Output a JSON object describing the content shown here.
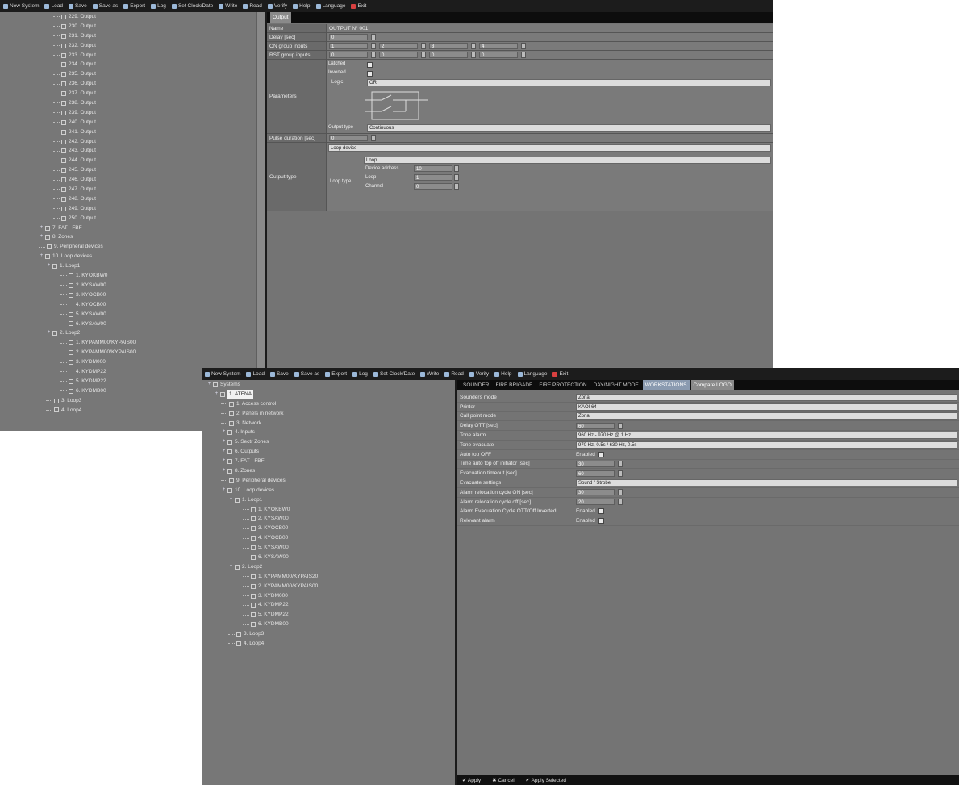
{
  "window1": {
    "top_mark": "-",
    "menu": [
      "New System",
      "Load",
      "Save",
      "Save as",
      "Export",
      "Log",
      "Set Clock/Date",
      "Write",
      "Read",
      "Verify",
      "Help",
      "Language",
      "Exit"
    ],
    "tree": [
      {
        "indent": 6,
        "label": "229. Output"
      },
      {
        "indent": 6,
        "label": "230. Output"
      },
      {
        "indent": 6,
        "label": "231. Output"
      },
      {
        "indent": 6,
        "label": "232. Output"
      },
      {
        "indent": 6,
        "label": "233. Output"
      },
      {
        "indent": 6,
        "label": "234. Output"
      },
      {
        "indent": 6,
        "label": "235. Output"
      },
      {
        "indent": 6,
        "label": "236. Output"
      },
      {
        "indent": 6,
        "label": "237. Output"
      },
      {
        "indent": 6,
        "label": "238. Output"
      },
      {
        "indent": 6,
        "label": "239. Output"
      },
      {
        "indent": 6,
        "label": "240. Output"
      },
      {
        "indent": 6,
        "label": "241. Output"
      },
      {
        "indent": 6,
        "label": "242. Output"
      },
      {
        "indent": 6,
        "label": "243. Output"
      },
      {
        "indent": 6,
        "label": "244. Output"
      },
      {
        "indent": 6,
        "label": "245. Output"
      },
      {
        "indent": 6,
        "label": "246. Output"
      },
      {
        "indent": 6,
        "label": "247. Output"
      },
      {
        "indent": 6,
        "label": "248. Output"
      },
      {
        "indent": 6,
        "label": "249. Output"
      },
      {
        "indent": 6,
        "label": "250. Output"
      },
      {
        "indent": 4,
        "exp": "+",
        "label": "7. FAT - FBF"
      },
      {
        "indent": 4,
        "exp": "+",
        "label": "8. Zones"
      },
      {
        "indent": 4,
        "label": "9. Peripheral devices"
      },
      {
        "indent": 4,
        "exp": "+",
        "label": "10. Loop devices"
      },
      {
        "indent": 5,
        "exp": "+",
        "label": "1. Loop1"
      },
      {
        "indent": 7,
        "label": "1. KYOKBW0"
      },
      {
        "indent": 7,
        "label": "2. KYSAW00"
      },
      {
        "indent": 7,
        "label": "3. KYOCB00"
      },
      {
        "indent": 7,
        "label": "4. KYOCB00"
      },
      {
        "indent": 7,
        "label": "5. KYSAW00"
      },
      {
        "indent": 7,
        "label": "6. KYSAW00"
      },
      {
        "indent": 5,
        "exp": "+",
        "label": "2. Loop2"
      },
      {
        "indent": 7,
        "label": "1. KYPAMM00/KYPAIS00"
      },
      {
        "indent": 7,
        "label": "2. KYPAMM00/KYPAIS00"
      },
      {
        "indent": 7,
        "label": "3. KYDM000"
      },
      {
        "indent": 7,
        "label": "4. KYDMP22"
      },
      {
        "indent": 7,
        "label": "5. KYDMP22"
      },
      {
        "indent": 7,
        "label": "6. KYDMB00"
      },
      {
        "indent": 5,
        "label": "3. Loop3"
      },
      {
        "indent": 5,
        "label": "4. Loop4"
      }
    ],
    "tab": "Output",
    "rows": {
      "name_label": "Name",
      "name_value": "OUTPUT N° 001",
      "delay_label": "Delay [sec]",
      "delay_value": "0",
      "on_group_label": "ON group inputs",
      "on_group_values": [
        "1",
        "2",
        "3",
        "4"
      ],
      "rst_group_label": "RST group inputs",
      "rst_group_values": [
        "0",
        "0",
        "0",
        "0"
      ],
      "params_label": "Parameters",
      "latched_label": "Latched",
      "inverted_label": "Inverted",
      "logic_label": "Logic",
      "logic_value": "OR",
      "output_type_row_label": "Output type",
      "output_type_value": "Continuous",
      "pulse_label": "Pulse duration [sec]",
      "pulse_value": "0",
      "output_type_label": "Output type",
      "device_value": "Loop device",
      "loop_type_label": "Loop type",
      "loop_value": "Loop",
      "device_address_label": "Device address",
      "device_address_value": "10",
      "loop_label": "Loop",
      "loop_num_value": "1",
      "channel_label": "Channel",
      "channel_value": "0"
    }
  },
  "window2": {
    "menu": [
      "New System",
      "Load",
      "Save",
      "Save as",
      "Export",
      "Log",
      "Set Clock/Date",
      "Write",
      "Read",
      "Verify",
      "Help",
      "Language",
      "Exit"
    ],
    "tree": [
      {
        "indent": 0,
        "exp": "+",
        "label": "Systems"
      },
      {
        "indent": 1,
        "exp": "+",
        "label": "1. ATENA",
        "selected": true
      },
      {
        "indent": 2,
        "label": "1. Access control"
      },
      {
        "indent": 2,
        "label": "2. Panels in network"
      },
      {
        "indent": 2,
        "label": "3. Network"
      },
      {
        "indent": 2,
        "exp": "+",
        "label": "4. Inputs"
      },
      {
        "indent": 2,
        "exp": "+",
        "label": "5. Sectr Zones"
      },
      {
        "indent": 2,
        "exp": "+",
        "label": "6. Outputs"
      },
      {
        "indent": 2,
        "exp": "+",
        "label": "7. FAT - FBF"
      },
      {
        "indent": 2,
        "exp": "+",
        "label": "8. Zones"
      },
      {
        "indent": 2,
        "label": "9. Peripheral devices"
      },
      {
        "indent": 2,
        "exp": "+",
        "label": "10. Loop devices"
      },
      {
        "indent": 3,
        "exp": "+",
        "label": "1. Loop1"
      },
      {
        "indent": 5,
        "label": "1. KYOKBW0"
      },
      {
        "indent": 5,
        "label": "2. KYSAW00"
      },
      {
        "indent": 5,
        "label": "3. KYOCB00"
      },
      {
        "indent": 5,
        "label": "4. KYOCB00"
      },
      {
        "indent": 5,
        "label": "5. KYSAW00"
      },
      {
        "indent": 5,
        "label": "6. KYSAW00"
      },
      {
        "indent": 3,
        "exp": "+",
        "label": "2. Loop2"
      },
      {
        "indent": 5,
        "label": "1. KYPAMM00/KYPAIS20"
      },
      {
        "indent": 5,
        "label": "2. KYPAMM00/KYPAIS00"
      },
      {
        "indent": 5,
        "label": "3. KYDM000"
      },
      {
        "indent": 5,
        "label": "4. KYDMP22"
      },
      {
        "indent": 5,
        "label": "5. KYDMP22"
      },
      {
        "indent": 5,
        "label": "6. KYDMB00"
      },
      {
        "indent": 3,
        "label": "3. Loop3"
      },
      {
        "indent": 3,
        "label": "4. Loop4"
      }
    ],
    "tabs": [
      "SOUNDER",
      "FIRE BRIGADE",
      "FIRE PROTECTION",
      "DAY/NIGHT MODE",
      "WORKSTATIONS",
      "Compare LOGO"
    ],
    "active_tab_index": 4,
    "rows": [
      {
        "label": "Sounders mode",
        "kind": "wide",
        "value": "Zonal"
      },
      {
        "label": "Printer",
        "kind": "wide",
        "value": "KAOI 64"
      },
      {
        "label": "Call point mode",
        "kind": "wide",
        "value": "Zonal"
      },
      {
        "label": "Delay OTT [sec]",
        "kind": "spin",
        "value": "60"
      },
      {
        "label": "Tone alarm",
        "kind": "wide",
        "value": "960 Hz - 970 Hz @ 1 Hz"
      },
      {
        "label": "Tone evacuate",
        "kind": "wide",
        "value": "970 Hz, 0.5s / 630 Hz, 0.5s"
      },
      {
        "label": "Auto top OFF",
        "kind": "check",
        "value": "Enabled"
      },
      {
        "label": "Time auto top off initiator [sec]",
        "kind": "spin",
        "value": "30"
      },
      {
        "label": "Evacuation timeout [sec]",
        "kind": "spin",
        "value": "60"
      },
      {
        "label": "Evacuate settings",
        "kind": "wide",
        "value": "Sound / Strobe"
      },
      {
        "label": "Alarm relocation cycle ON [sec]",
        "kind": "spin",
        "value": "30"
      },
      {
        "label": "Alarm relocation cycle off [sec]",
        "kind": "spin",
        "value": "20"
      },
      {
        "label": "Alarm Evacuation Cycle OTT/Off Inverted",
        "kind": "check",
        "value": "Enabled"
      },
      {
        "label": "Relevant alarm",
        "kind": "check",
        "value": "Enabled"
      }
    ],
    "buttons": {
      "apply": "Apply",
      "cancel": "Cancel",
      "apply_selected": "Apply Selected"
    }
  }
}
